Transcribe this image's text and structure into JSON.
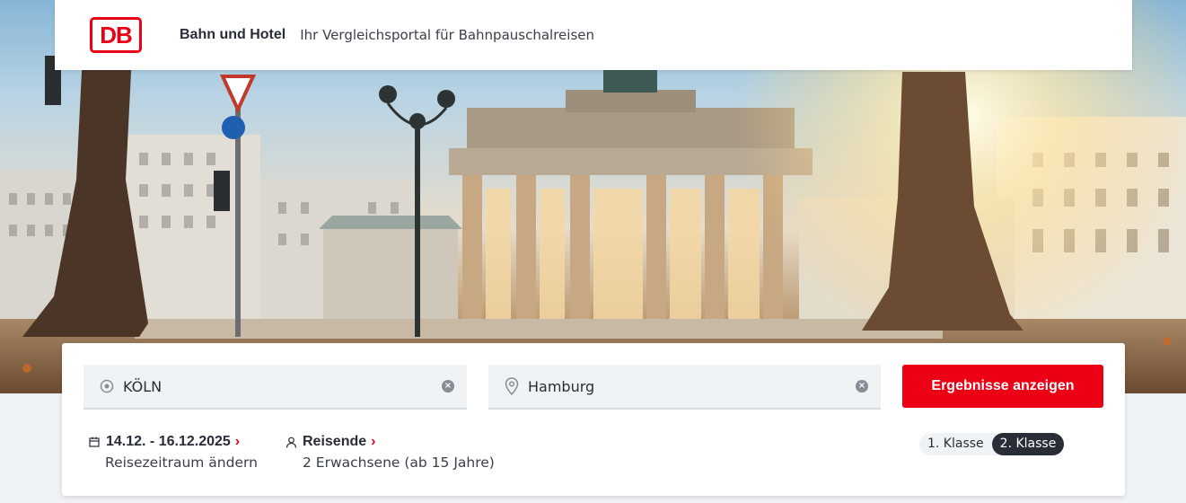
{
  "header": {
    "logo_text": "DB",
    "brand": "Bahn und Hotel",
    "tagline": "Ihr Vergleichsportal für Bahnpauschalreisen"
  },
  "search": {
    "from_value": "KÖLN",
    "from_icon": "origin-circle-icon",
    "to_value": "Hamburg",
    "to_icon": "location-pin-icon",
    "clear_icon": "clear-icon",
    "submit_label": "Ergebnisse anzeigen",
    "dates": {
      "title": "14.12. - 16.12.2025",
      "subtitle": "Reisezeitraum ändern",
      "icon": "calendar-icon"
    },
    "travelers": {
      "title": "Reisende",
      "subtitle": "2 Erwachsene (ab 15 Jahre)",
      "icon": "person-icon"
    },
    "classes": [
      {
        "label": "1. Klasse",
        "active": false
      },
      {
        "label": "2. Klasse",
        "active": true
      }
    ]
  },
  "colors": {
    "accent": "#ec0016",
    "dark": "#282d37",
    "field_bg": "#f0f3f5"
  }
}
